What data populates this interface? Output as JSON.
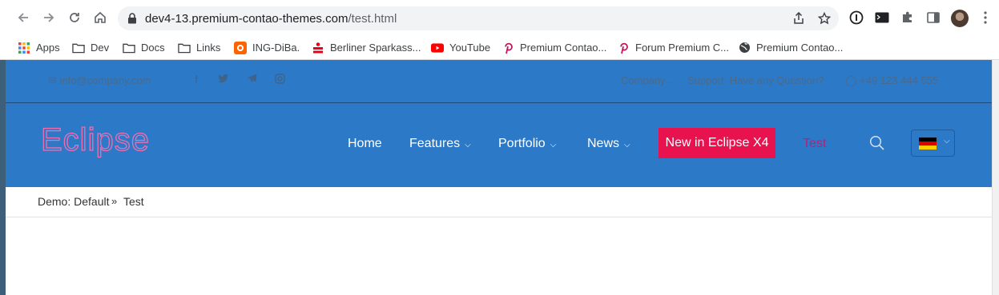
{
  "browser": {
    "url_host": "dev4-13.premium-contao-themes.com",
    "url_path": "/test.html",
    "bookmarks": [
      {
        "label": "Apps",
        "icon": "apps-grid-icon"
      },
      {
        "label": "Dev",
        "icon": "folder-icon"
      },
      {
        "label": "Docs",
        "icon": "folder-icon"
      },
      {
        "label": "Links",
        "icon": "folder-icon"
      },
      {
        "label": "ING-DiBa.",
        "icon": "ing-diba-icon"
      },
      {
        "label": "Berliner Sparkass...",
        "icon": "sparkasse-icon"
      },
      {
        "label": "YouTube",
        "icon": "youtube-icon"
      },
      {
        "label": "Premium Contao...",
        "icon": "pinterest-icon"
      },
      {
        "label": "Forum Premium C...",
        "icon": "pinterest-icon"
      },
      {
        "label": "Premium Contao...",
        "icon": "globe-icon"
      }
    ]
  },
  "site": {
    "topbar": {
      "email": "info@company.com",
      "company": "Company",
      "support": "Support: Have any Question?",
      "phone": "+49 123 444 555"
    },
    "logo": "Eclipse",
    "menu": {
      "home": "Home",
      "features": "Features",
      "portfolio": "Portfolio",
      "news": "News",
      "cta": "New in Eclipse X4",
      "test": "Test"
    },
    "breadcrumb": {
      "root": "Demo: Default",
      "current": "Test"
    }
  },
  "colors": {
    "brand_blue": "#2b79c7",
    "cta_red": "#e8124f",
    "active_menu": "#b0247a",
    "logo_pink": "#f06db0"
  }
}
